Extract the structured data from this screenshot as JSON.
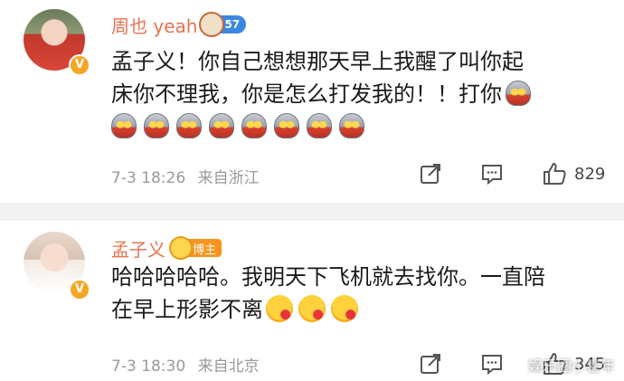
{
  "comments": [
    {
      "username": "周也 yeah",
      "level": "57",
      "text_line1": "孟子义！你自己想想那天早上我醒了叫你起",
      "text_line2": "床你不理我，你是怎么打发我的！！打你",
      "emoji": "ultraman-emoji",
      "emoji_count_line2": 1,
      "emoji_count_line3": 8,
      "time": "7-3 18:26",
      "location": "来自浙江",
      "likes": "829"
    },
    {
      "username": "孟子义",
      "host_label": "博主",
      "text_line1": "哈哈哈哈哈。我明天下飞机就去找你。一直陪",
      "text_line2": "在早上形影不离",
      "emoji": "kiss-face-emoji",
      "emoji_count_line2": 3,
      "time": "7-3 18:30",
      "location": "来自北京",
      "likes": "345"
    }
  ],
  "verified_badge": "V",
  "watermark": "娱乐圈小喜年",
  "colors": {
    "username": "#eb7350",
    "text": "#1a1a1a",
    "meta": "#9a9a9a",
    "separator": "#f2f2f2",
    "level_badge": "#3b87e0",
    "host_badge": "#f7941d"
  }
}
